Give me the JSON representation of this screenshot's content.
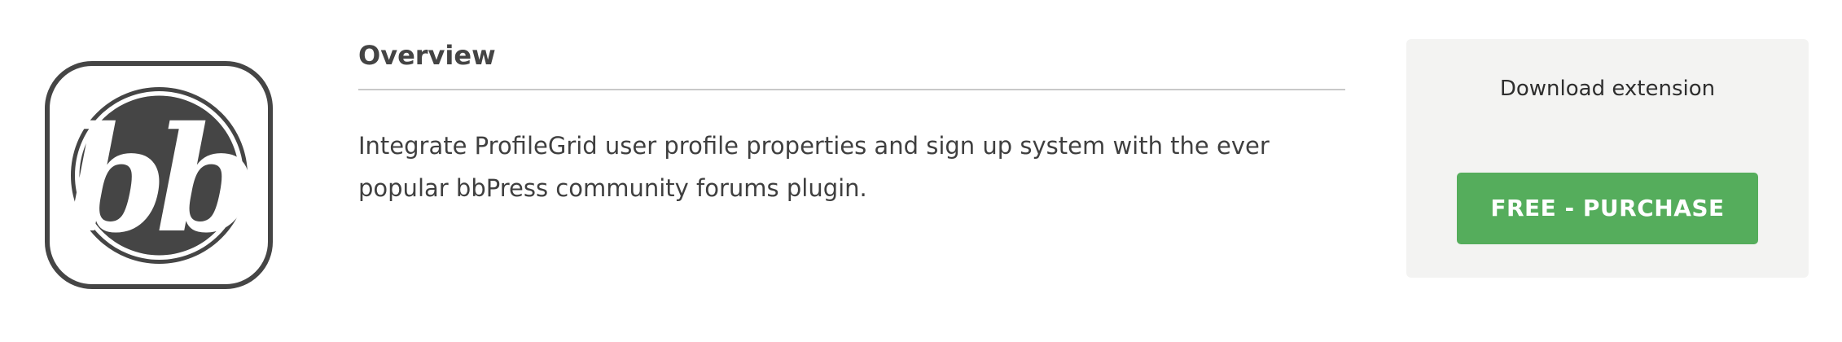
{
  "extension": {
    "logo_icon": "bbpress-logo-icon",
    "logo_text": "bb"
  },
  "overview": {
    "title": "Overview",
    "description": "Integrate ProfileGrid user profile properties and sign up system with the ever popular bbPress community forums plugin."
  },
  "download": {
    "label": "Download extension",
    "button_label": "FREE - PURCHASE",
    "button_color": "#55ad5c"
  },
  "colors": {
    "logo": "#454545",
    "panel_background": "#f3f3f2",
    "divider": "#c9c9c9"
  }
}
